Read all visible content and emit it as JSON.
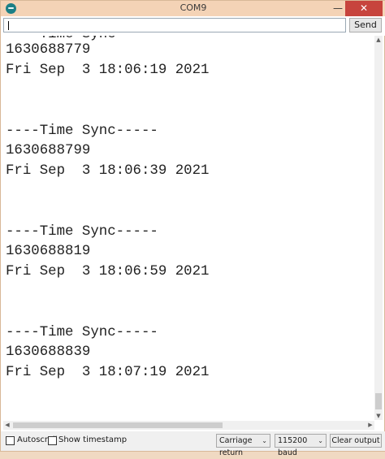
{
  "window": {
    "title": "COM9",
    "minimize_glyph": "—",
    "maximize_glyph": "□",
    "close_glyph": "✕"
  },
  "input": {
    "value": "",
    "send_label": "Send"
  },
  "serial_output": {
    "lines": [
      "----Time Sync-----",
      "1630688779",
      "Fri Sep  3 18:06:19 2021",
      "",
      "",
      "----Time Sync-----",
      "1630688799",
      "Fri Sep  3 18:06:39 2021",
      "",
      "",
      "----Time Sync-----",
      "1630688819",
      "Fri Sep  3 18:06:59 2021",
      "",
      "",
      "----Time Sync-----",
      "1630688839",
      "Fri Sep  3 18:07:19 2021"
    ]
  },
  "footer": {
    "autoscroll_label": "Autoscroll",
    "autoscroll_checked": false,
    "timestamp_label": "Show timestamp",
    "timestamp_checked": false,
    "line_ending_value": "Carriage return",
    "baud_value": "115200 baud",
    "clear_label": "Clear output"
  },
  "colors": {
    "titlebar": "#f4d3b6",
    "close_button": "#c7443d",
    "app_icon": "#1b7f86"
  },
  "icons": {
    "app": "arduino-icon",
    "dropdown": "chevron-down-icon"
  }
}
